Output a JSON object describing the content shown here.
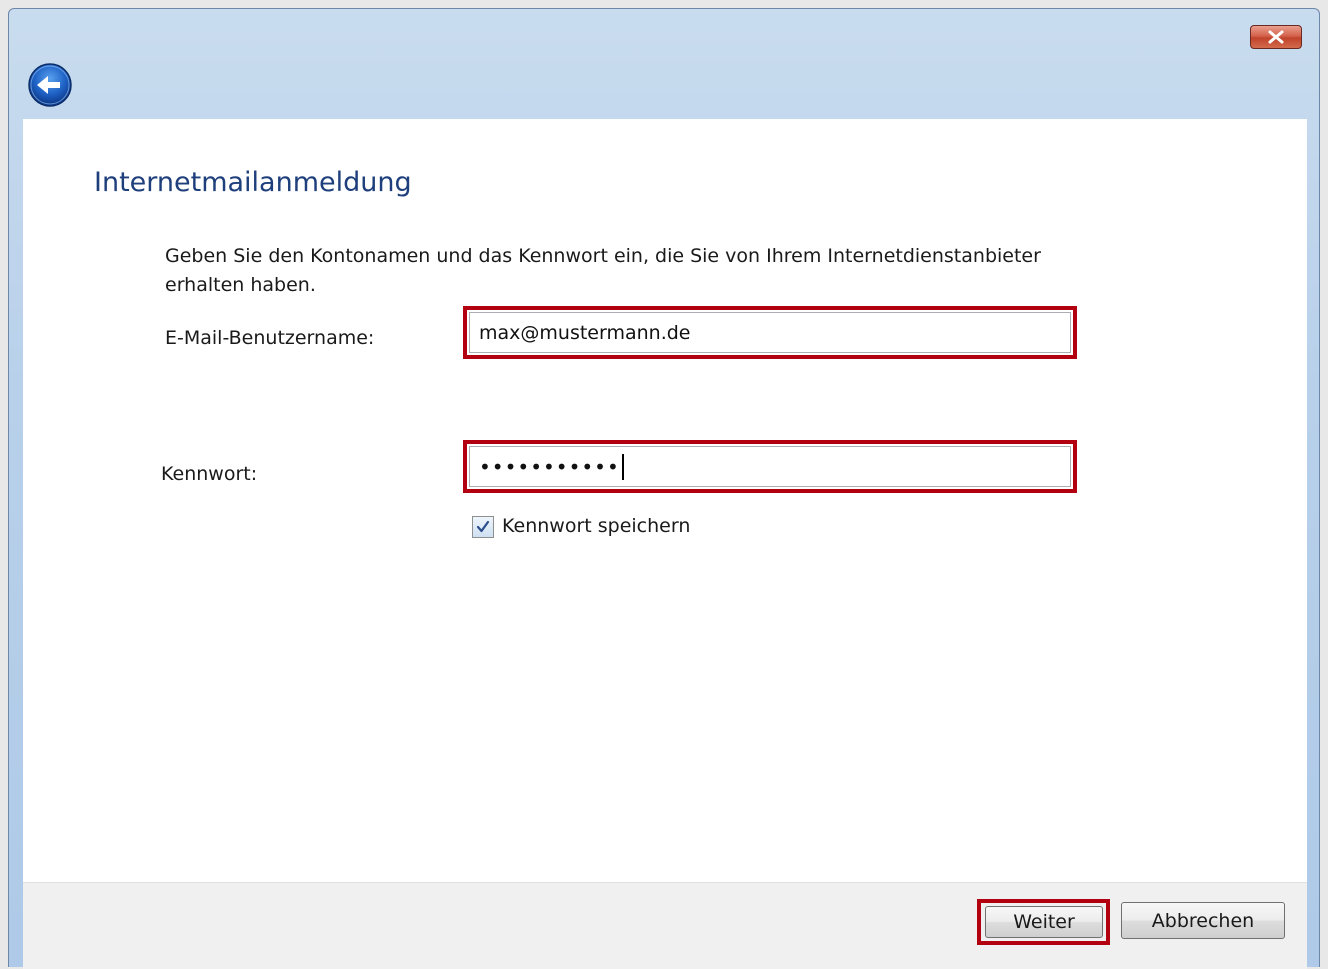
{
  "window": {
    "close_icon": "close-icon",
    "back_icon": "back-arrow-icon"
  },
  "page": {
    "title": "Internetmailanmeldung",
    "instruction": "Geben Sie den Kontonamen und das Kennwort ein, die Sie von Ihrem Internetdienstanbieter erhalten haben."
  },
  "form": {
    "username_label": "E-Mail-Benutzername:",
    "username_value": "max@mustermann.de",
    "password_label": "Kennwort:",
    "password_value": "•••••••••••",
    "remember_label": "Kennwort speichern",
    "remember_checked": true
  },
  "footer": {
    "next_label": "Weiter",
    "cancel_label": "Abbrechen"
  },
  "colors": {
    "highlight": "#b30011",
    "title": "#1e3f7b",
    "window_chrome": "#b8d0ea"
  }
}
